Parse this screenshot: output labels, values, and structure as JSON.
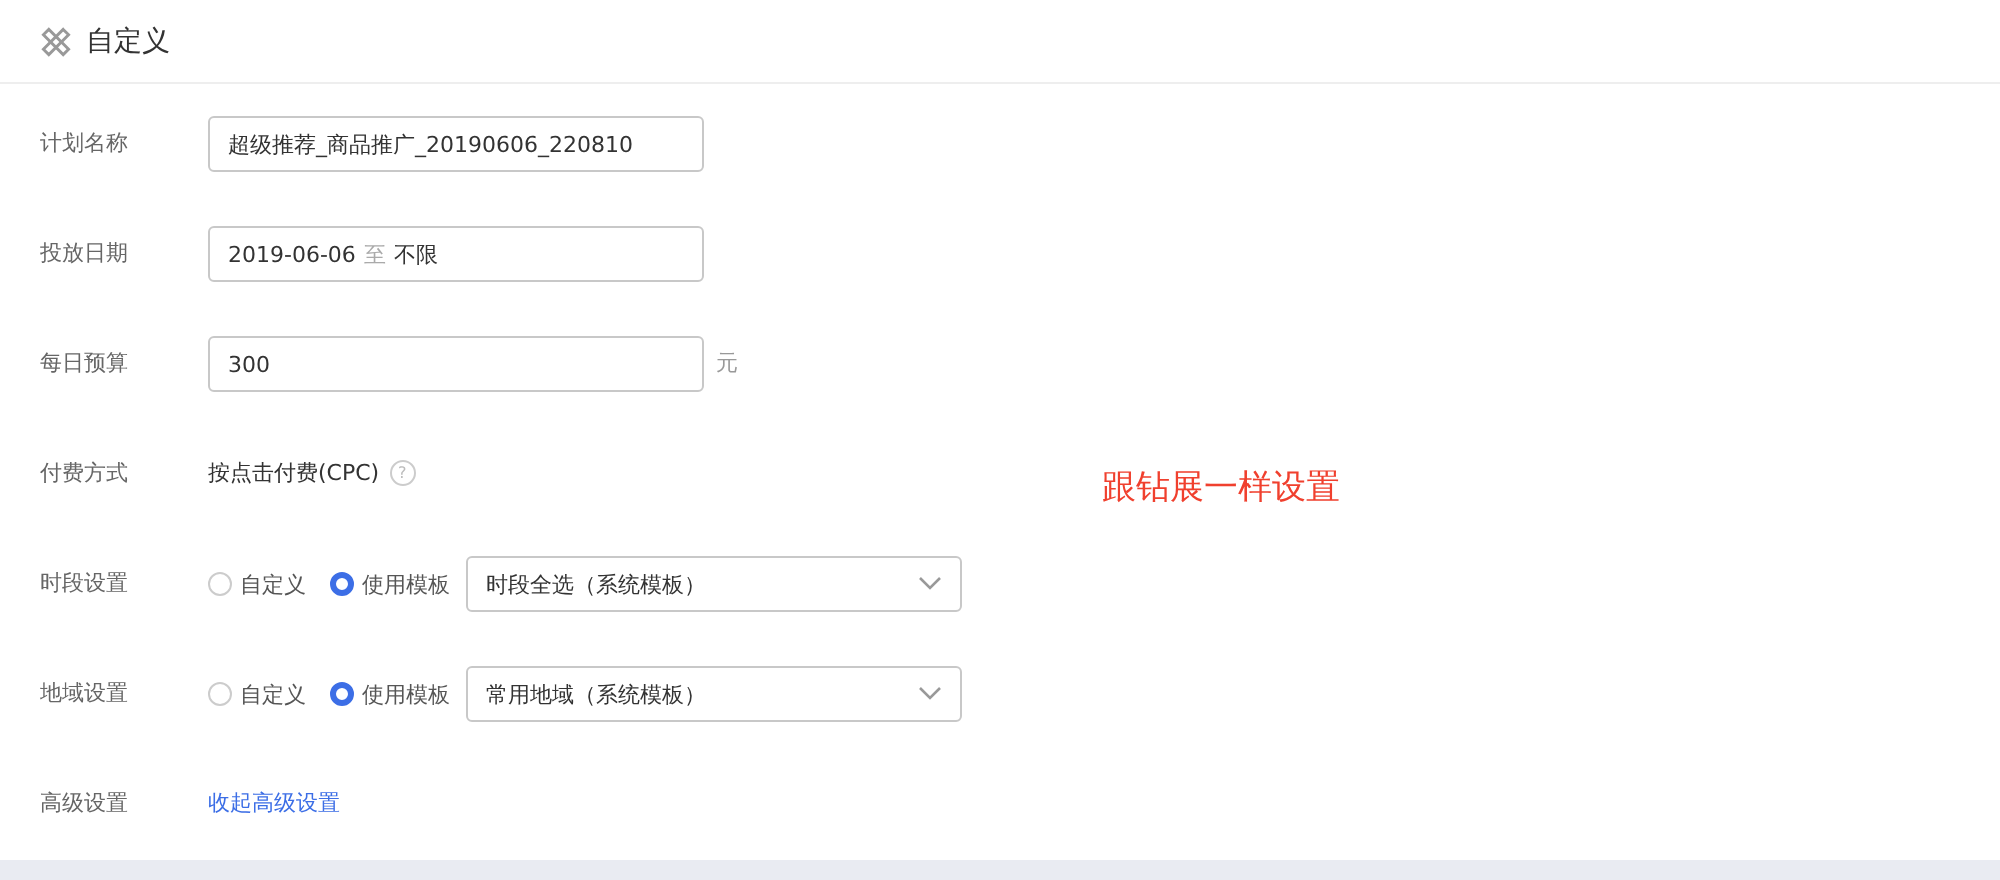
{
  "header": {
    "title": "自定义"
  },
  "rows": [
    {
      "kind": "input",
      "label": "计划名称",
      "value": "超级推荐_商品推广_20190606_220810"
    },
    {
      "kind": "date",
      "label": "投放日期",
      "start": "2019-06-06",
      "separator": "至",
      "end": "不限"
    },
    {
      "kind": "input",
      "label": "每日预算",
      "value": "300",
      "unit": "元"
    },
    {
      "kind": "text",
      "label": "付费方式",
      "value": "按点击付费(CPC)",
      "help": "?"
    },
    {
      "kind": "radio-select",
      "label": "时段设置",
      "options": [
        {
          "label": "自定义",
          "selected": false
        },
        {
          "label": "使用模板",
          "selected": true
        }
      ],
      "select": "时段全选（系统模板）"
    },
    {
      "kind": "radio-select",
      "label": "地域设置",
      "options": [
        {
          "label": "自定义",
          "selected": false
        },
        {
          "label": "使用模板",
          "selected": true
        }
      ],
      "select": "常用地域（系统模板）"
    },
    {
      "kind": "link",
      "label": "高级设置",
      "link": "收起高级设置"
    }
  ],
  "annotation": "跟钻展一样设置"
}
